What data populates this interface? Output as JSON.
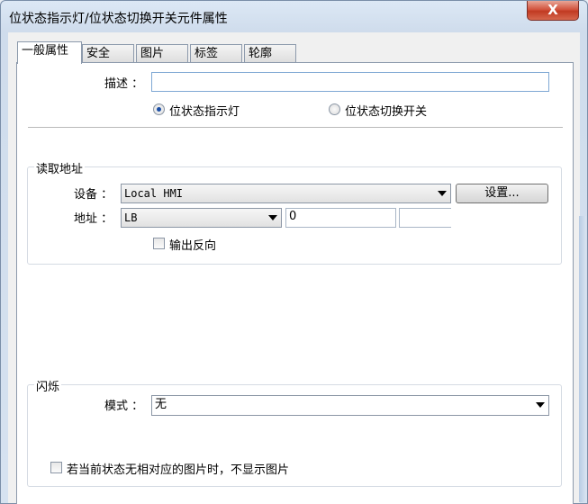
{
  "window": {
    "title": "位状态指示灯/位状态切换开关元件属性",
    "close_label": "X"
  },
  "tabs": [
    {
      "label": "一般属性",
      "active": true
    },
    {
      "label": "安全",
      "active": false
    },
    {
      "label": "图片",
      "active": false
    },
    {
      "label": "标签",
      "active": false
    },
    {
      "label": "轮廓",
      "active": false
    }
  ],
  "general": {
    "description_label": "描述 ：",
    "description_value": "",
    "radio_indicator": "位状态指示灯",
    "radio_switch": "位状态切换开关",
    "selected": "位状态指示灯"
  },
  "read_address": {
    "group_title": "读取地址",
    "device_label": "设备 ：",
    "device_value": "Local HMI",
    "settings_button": "设置...",
    "address_label": "地址 ：",
    "address_type": "LB",
    "address_value": "0",
    "address_extra": "",
    "invert_output_label": "输出反向",
    "invert_output_checked": false
  },
  "blink": {
    "group_title": "闪烁",
    "mode_label": "模式 ：",
    "mode_value": "无",
    "no_picture_label": "若当前状态无相对应的图片时，不显示图片",
    "no_picture_checked": false
  }
}
